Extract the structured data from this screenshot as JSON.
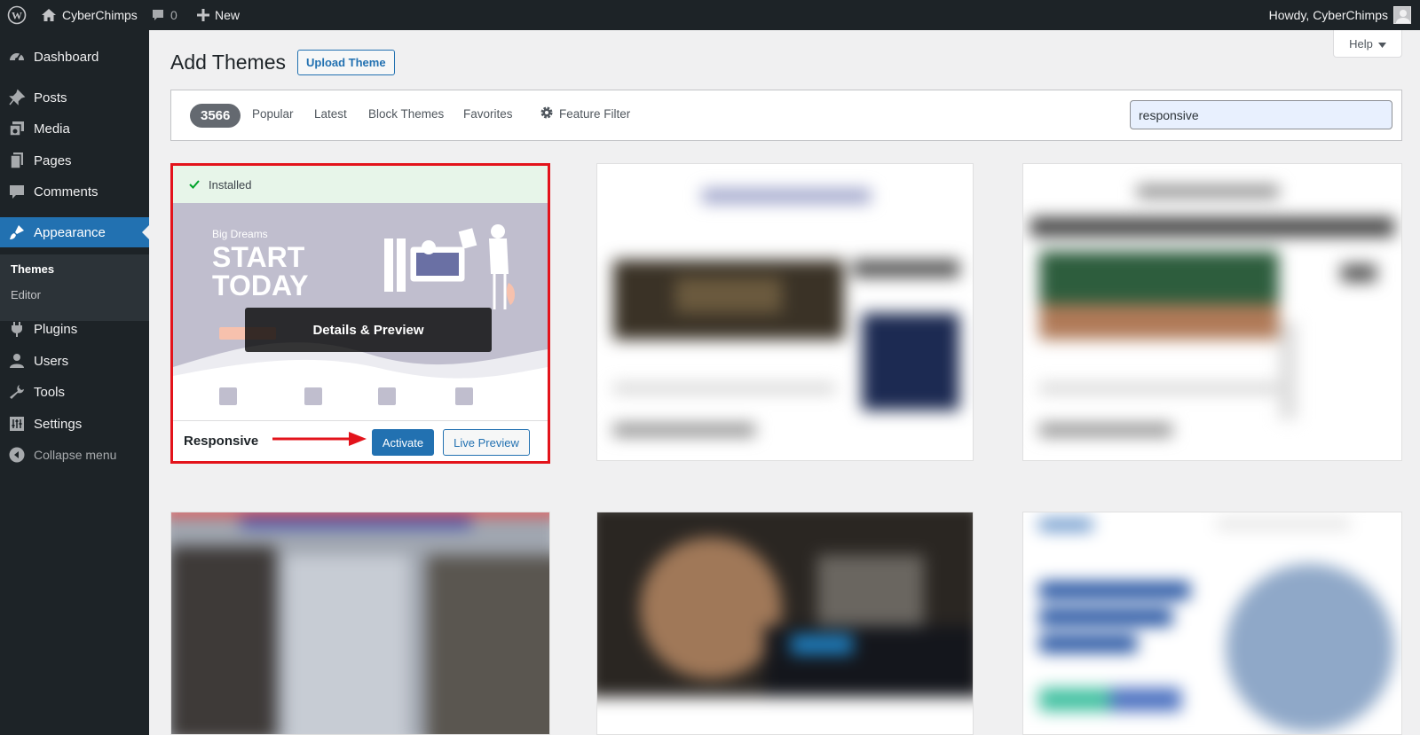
{
  "admin_bar": {
    "site_name": "CyberChimps",
    "comments_count": "0",
    "new_label": "New",
    "howdy": "Howdy, CyberChimps"
  },
  "sidebar": {
    "items": [
      {
        "label": "Dashboard",
        "icon": "dashboard-icon"
      },
      {
        "label": "Posts",
        "icon": "pin-icon"
      },
      {
        "label": "Media",
        "icon": "media-icon"
      },
      {
        "label": "Pages",
        "icon": "pages-icon"
      },
      {
        "label": "Comments",
        "icon": "comment-icon"
      },
      {
        "label": "Appearance",
        "icon": "brush-icon",
        "active": true
      },
      {
        "label": "Plugins",
        "icon": "plugin-icon"
      },
      {
        "label": "Users",
        "icon": "users-icon"
      },
      {
        "label": "Tools",
        "icon": "wrench-icon"
      },
      {
        "label": "Settings",
        "icon": "settings-icon"
      }
    ],
    "submenu": [
      {
        "label": "Themes",
        "current": true
      },
      {
        "label": "Editor"
      }
    ],
    "collapse_label": "Collapse menu"
  },
  "help_label": "Help",
  "page_title": "Add Themes",
  "upload_button": "Upload Theme",
  "filter_bar": {
    "count": "3566",
    "links": [
      "Popular",
      "Latest",
      "Block Themes",
      "Favorites"
    ],
    "feature_filter": "Feature Filter",
    "search_value": "responsive"
  },
  "featured_theme": {
    "installed_label": "Installed",
    "screenshot_small": "Big Dreams",
    "screenshot_big_1": "START",
    "screenshot_big_2": "TODAY",
    "details_label": "Details & Preview",
    "name": "Responsive",
    "activate_label": "Activate",
    "preview_label": "Live Preview"
  },
  "colors": {
    "admin_dark": "#1d2327",
    "accent": "#2271b1",
    "highlight_border": "#e3131b",
    "arrow": "#e3131b"
  }
}
